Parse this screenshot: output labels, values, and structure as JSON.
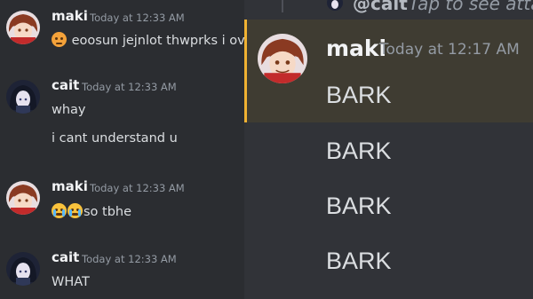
{
  "left_chat": {
    "messages": [
      {
        "username": "maki",
        "timestamp": "Today at 12:33 AM",
        "avatar": "maki-avatar",
        "lines": [
          "eoosun jejnlot thwprks i ov"
        ]
      },
      {
        "username": "cait",
        "timestamp": "Today at 12:33 AM",
        "avatar": "cait-avatar",
        "lines": [
          "whay",
          "i cant understand u"
        ]
      },
      {
        "username": "maki",
        "timestamp": "Today at 12:33 AM",
        "avatar": "maki-avatar",
        "lines": [
          "so tbhe"
        ]
      },
      {
        "username": "cait",
        "timestamp": "Today at 12:33 AM",
        "avatar": "cait-avatar",
        "lines": [
          "WHAT"
        ]
      }
    ]
  },
  "right_chat": {
    "reply_preview": {
      "username": "@cait",
      "text": "Tap to see attach"
    },
    "message": {
      "username": "maki",
      "timestamp": "Today at 12:17 AM",
      "lines": [
        "BARK",
        "BARK",
        "BARK",
        "BARK"
      ]
    }
  },
  "colors": {
    "left_bg": "#2b2d31",
    "right_bg": "#313338",
    "highlight_bg": "#3f3c32",
    "highlight_bar": "#f0b232",
    "username": "#f2f3f5",
    "timestamp": "#949ba4",
    "text": "#dbdee1"
  },
  "icons": [
    "angry-face-emoji-icon",
    "crying-face-emoji-icon"
  ]
}
